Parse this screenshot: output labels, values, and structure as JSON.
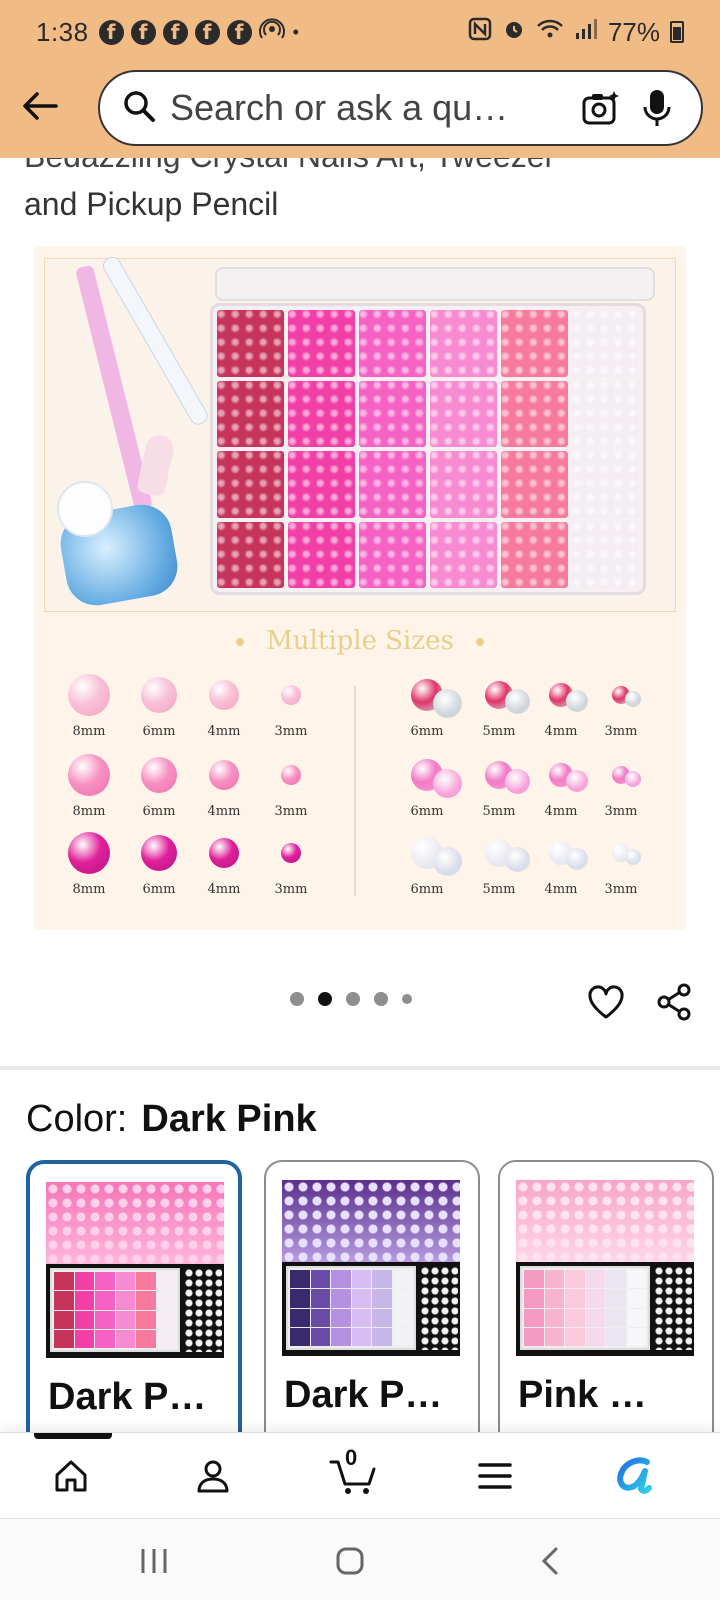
{
  "status_bar": {
    "time": "1:38",
    "battery": "77%",
    "app_icons": [
      "facebook-icon",
      "facebook-icon",
      "facebook-icon",
      "facebook-icon",
      "facebook-icon"
    ]
  },
  "search": {
    "placeholder": "Search or ask a qu…"
  },
  "product": {
    "title_line1": "Bedazzling Crystal Nails Art, Tweezer",
    "title_line2": "and Pickup Pencil",
    "image": {
      "heading": "Multiple Sizes",
      "pearl_sizes": [
        "8mm",
        "6mm",
        "4mm",
        "3mm"
      ],
      "crystal_sizes": [
        "6mm",
        "5mm",
        "4mm",
        "3mm"
      ]
    },
    "carousel": {
      "total": 5,
      "active_index": 1
    }
  },
  "color": {
    "label": "Color:",
    "value": "Dark Pink"
  },
  "variants": [
    {
      "label": "Dark P…",
      "selected": true
    },
    {
      "label": "Dark P…",
      "selected": false
    },
    {
      "label": "Pink …",
      "selected": false
    }
  ],
  "bottom_nav": {
    "cart_count": "0",
    "items": [
      "home-icon",
      "account-icon",
      "cart-icon",
      "menu-icon",
      "rufus-icon"
    ]
  },
  "colors": {
    "header_bg": "#f1bb85",
    "selected_border": "#2162a1",
    "rufus_accent": "#1aa7e8"
  }
}
